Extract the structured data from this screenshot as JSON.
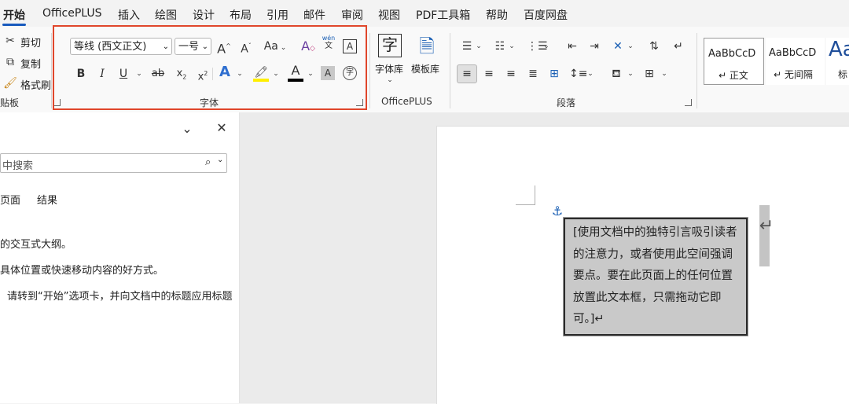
{
  "menu": {
    "items": [
      "开始",
      "OfficePLUS",
      "插入",
      "绘图",
      "设计",
      "布局",
      "引用",
      "邮件",
      "审阅",
      "视图",
      "PDF工具箱",
      "帮助",
      "百度网盘"
    ]
  },
  "clipboard": {
    "cut": "剪切",
    "copy": "复制",
    "format_painter": "格式刷",
    "group_label": "贴板"
  },
  "font": {
    "font_name": "等线 (西文正文)",
    "font_size": "一号",
    "grow_glyph": "A",
    "shrink_glyph": "A",
    "change_case": "Aa",
    "phonetic_top": "wén",
    "phonetic_bottom": "文",
    "border_char": "A",
    "bold": "B",
    "italic": "I",
    "underline": "U",
    "strikethrough": "ab",
    "subscript": "x",
    "superscript": "x",
    "text_effects": "A",
    "font_color": "A",
    "char_shading": "A",
    "enclose_char": "字",
    "group_label": "字体"
  },
  "officeplus": {
    "font_lib": "字体库",
    "template_lib": "模板库",
    "font_lib_icon": "字",
    "group_label": "OfficePLUS"
  },
  "paragraph": {
    "group_label": "段落"
  },
  "styles": {
    "items": [
      {
        "preview": "AaBbCcD",
        "name": "↵ 正文"
      },
      {
        "preview": "AaBbCcD",
        "name": "↵ 无间隔"
      },
      {
        "preview": "Aa",
        "name": "标"
      }
    ]
  },
  "nav_pane": {
    "search_placeholder": "中搜索",
    "tabs": [
      "页面",
      "结果"
    ],
    "lines": [
      "的交互式大纲。",
      "具体位置或快速移动内容的好方式。",
      "请转到“开始”选项卡，并向文档中的标题应用标题"
    ]
  },
  "document": {
    "quote_text": "[使用文档中的独特引言吸引读者的注意力，或者使用此空间强调要点。要在此页面上的任何位置放置此文本框，只需拖动它即可。]↵",
    "return_mark": "↵"
  },
  "colors": {
    "accent": "#185abd",
    "highlight_border": "#e0462b",
    "highlight_yellow": "#ffef00",
    "font_color_bar": "#000000"
  }
}
